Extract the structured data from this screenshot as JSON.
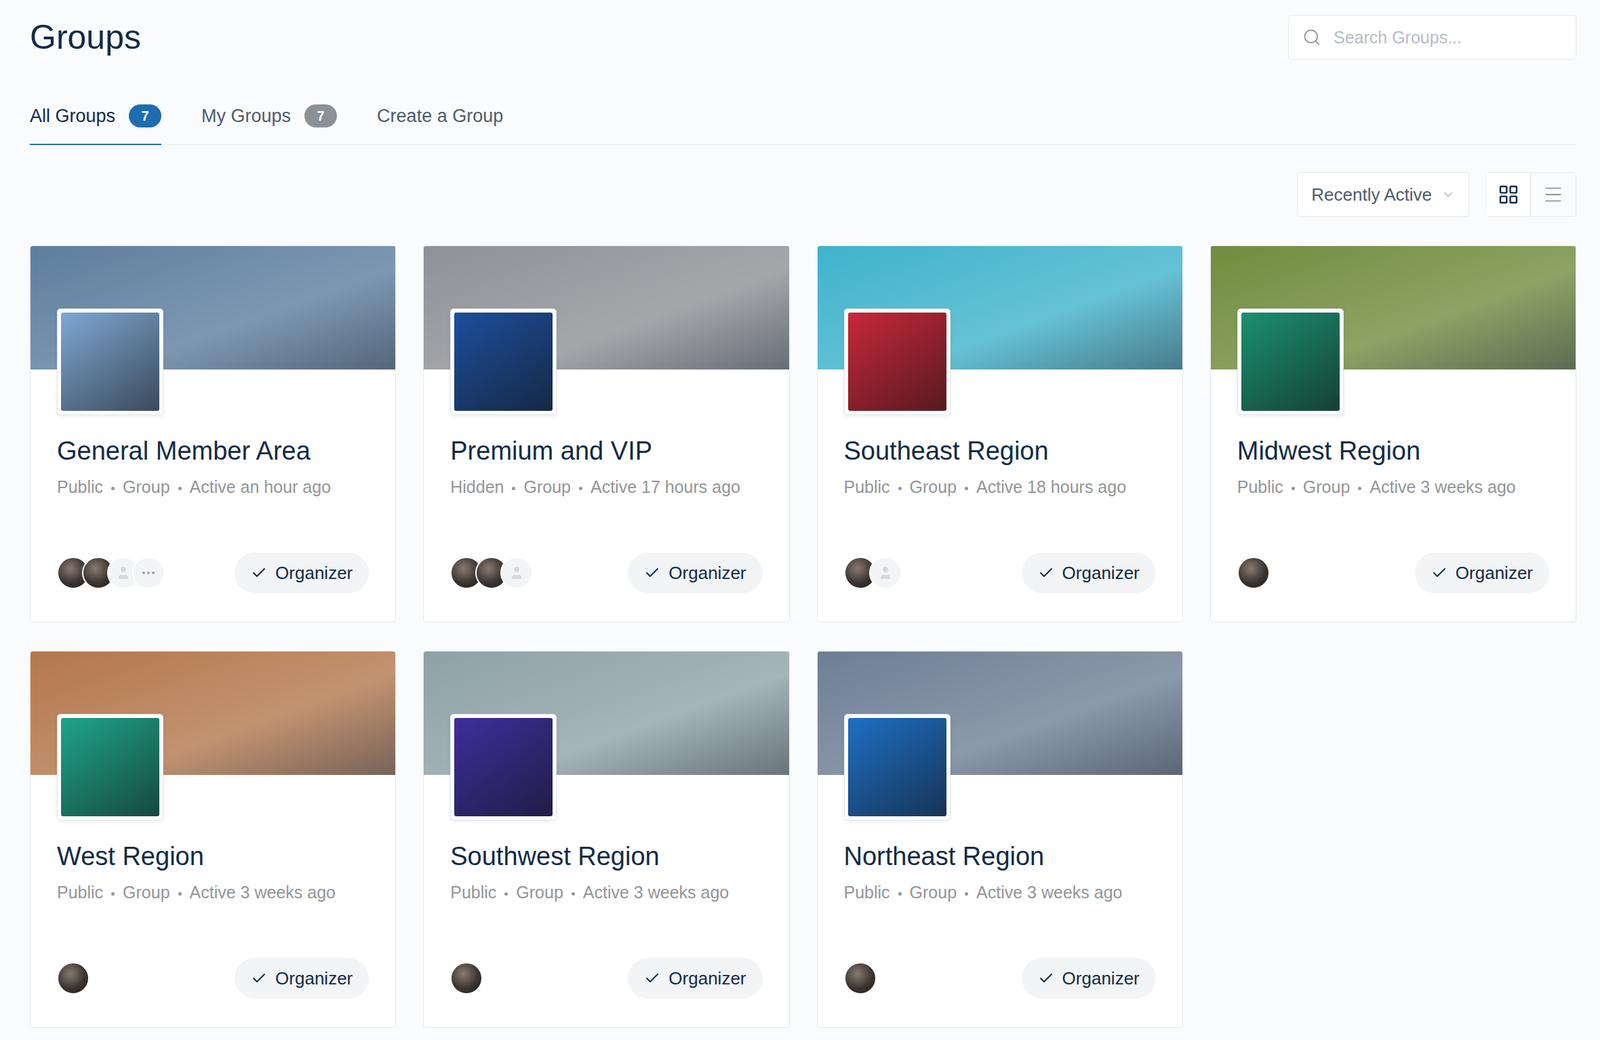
{
  "page": {
    "title": "Groups"
  },
  "search": {
    "placeholder": "Search Groups..."
  },
  "tabs": [
    {
      "label": "All Groups",
      "count": "7",
      "selected": true
    },
    {
      "label": "My Groups",
      "count": "7",
      "selected": false
    },
    {
      "label": "Create a Group",
      "count": "",
      "selected": false
    }
  ],
  "sort": {
    "label": "Recently Active"
  },
  "views": [
    {
      "kind": "grid",
      "selected": true
    },
    {
      "kind": "list",
      "selected": false
    }
  ],
  "groups": [
    {
      "name": "General Member Area",
      "privacy": "Public",
      "type": "Group",
      "activity": "Active an hour ago",
      "cover_color": "#5d7e9f",
      "avatar_color": "#7fa8d4",
      "members": [
        {
          "kind": "photo"
        },
        {
          "kind": "photo"
        },
        {
          "kind": "placeholder"
        },
        {
          "kind": "more"
        }
      ],
      "membership": {
        "label": "Organizer",
        "checked": true
      }
    },
    {
      "name": "Premium and VIP",
      "privacy": "Hidden",
      "type": "Group",
      "activity": "Active 17 hours ago",
      "cover_color": "#8e9196",
      "avatar_color": "#1d4f9c",
      "members": [
        {
          "kind": "photo"
        },
        {
          "kind": "photo"
        },
        {
          "kind": "placeholder"
        }
      ],
      "membership": {
        "label": "Organizer",
        "checked": true
      }
    },
    {
      "name": "Southeast Region",
      "privacy": "Public",
      "type": "Group",
      "activity": "Active 18 hours ago",
      "cover_color": "#3fb3cc",
      "avatar_color": "#c8283a",
      "members": [
        {
          "kind": "photo"
        },
        {
          "kind": "placeholder"
        }
      ],
      "membership": {
        "label": "Organizer",
        "checked": true
      }
    },
    {
      "name": "Midwest Region",
      "privacy": "Public",
      "type": "Group",
      "activity": "Active 3 weeks ago",
      "cover_color": "#718c3e",
      "avatar_color": "#1c9070",
      "members": [
        {
          "kind": "photo"
        }
      ],
      "membership": {
        "label": "Organizer",
        "checked": true
      }
    },
    {
      "name": "West Region",
      "privacy": "Public",
      "type": "Group",
      "activity": "Active 3 weeks ago",
      "cover_color": "#b4774c",
      "avatar_color": "#1fa58a",
      "members": [
        {
          "kind": "photo"
        }
      ],
      "membership": {
        "label": "Organizer",
        "checked": true
      }
    },
    {
      "name": "Southwest Region",
      "privacy": "Public",
      "type": "Group",
      "activity": "Active 3 weeks ago",
      "cover_color": "#8ea2a6",
      "avatar_color": "#3d2f9c",
      "members": [
        {
          "kind": "photo"
        }
      ],
      "membership": {
        "label": "Organizer",
        "checked": true
      }
    },
    {
      "name": "Northeast Region",
      "privacy": "Public",
      "type": "Group",
      "activity": "Active 3 weeks ago",
      "cover_color": "#6e7f95",
      "avatar_color": "#1f6fc4",
      "members": [
        {
          "kind": "photo"
        }
      ],
      "membership": {
        "label": "Organizer",
        "checked": true
      }
    }
  ]
}
